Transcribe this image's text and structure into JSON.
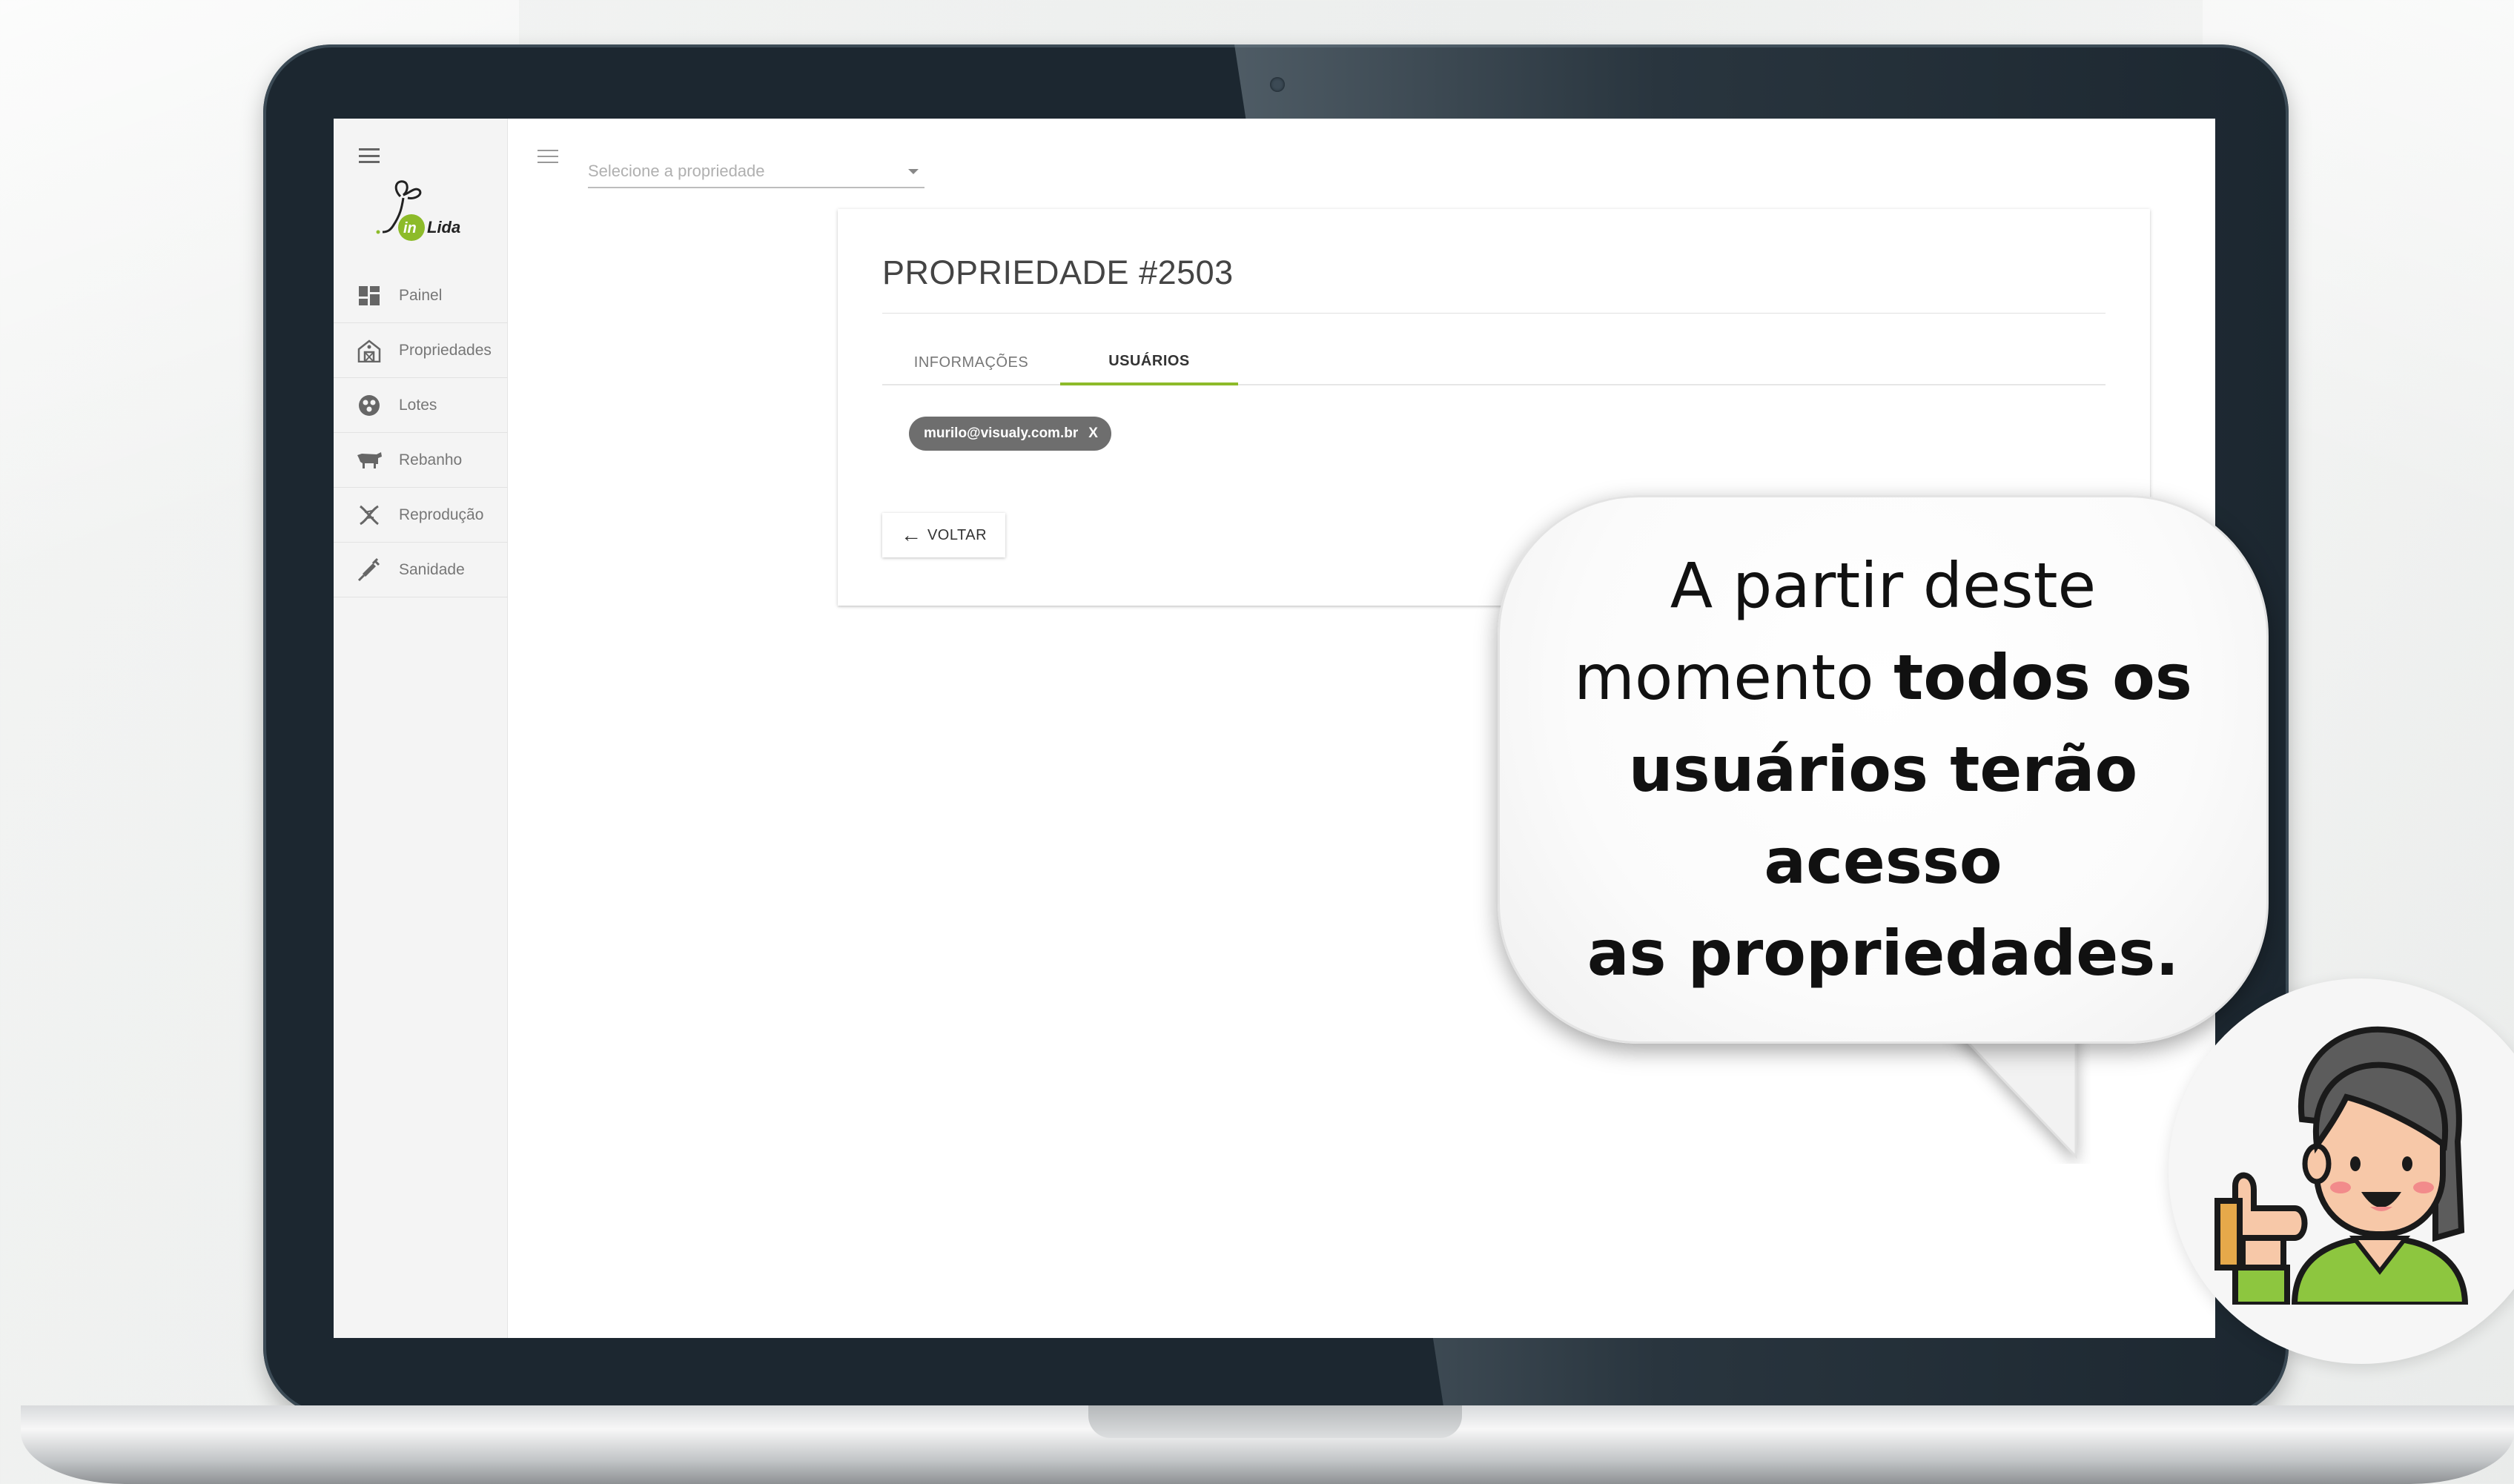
{
  "app": {
    "logo_text": "inLida",
    "menu_icon": "menu-icon"
  },
  "sidebar": {
    "items": [
      {
        "label": "Painel",
        "icon": "dashboard-icon"
      },
      {
        "label": "Propriedades",
        "icon": "barn-icon"
      },
      {
        "label": "Lotes",
        "icon": "group-icon"
      },
      {
        "label": "Rebanho",
        "icon": "cow-icon"
      },
      {
        "label": "Reprodução",
        "icon": "dna-icon"
      },
      {
        "label": "Sanidade",
        "icon": "syringe-icon"
      }
    ]
  },
  "topbar": {
    "property_select_placeholder": "Selecione a propriedade"
  },
  "card": {
    "title": "PROPRIEDADE #2503",
    "tabs": [
      {
        "label": "INFORMAÇÕES",
        "active": false
      },
      {
        "label": "USUÁRIOS",
        "active": true
      }
    ],
    "user_chip": {
      "email": "murilo@visualy.com.br",
      "remove_label": "X"
    },
    "back_button": {
      "label": "VOLTAR",
      "icon": "arrow-left-icon"
    }
  },
  "callout": {
    "line1": "A partir deste",
    "line2_normal": "momento",
    "line2_bold": "todos os",
    "line3": "usuários terão acesso",
    "line4": "as propriedades."
  },
  "colors": {
    "accent": "#8dbb2a",
    "chip_bg": "#6e6e6e",
    "bezel": "#1c2730"
  }
}
